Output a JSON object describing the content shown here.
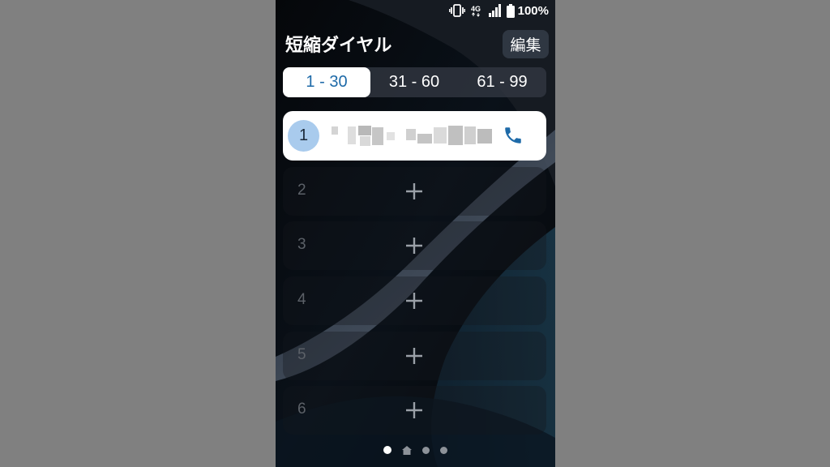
{
  "status_bar": {
    "icons": [
      "vibrate-icon",
      "4g-icon",
      "signal-icon",
      "battery-icon"
    ],
    "network": "4G",
    "battery": "100%"
  },
  "header": {
    "title": "短縮ダイヤル",
    "edit_label": "編集"
  },
  "tabs": [
    {
      "label": "1 - 30",
      "active": true
    },
    {
      "label": "31 - 60",
      "active": false
    },
    {
      "label": "61 - 99",
      "active": false
    }
  ],
  "entries": [
    {
      "number": "1",
      "assigned": true,
      "icon": "phone-icon"
    },
    {
      "number": "2",
      "assigned": false,
      "icon": "plus-icon"
    },
    {
      "number": "3",
      "assigned": false,
      "icon": "plus-icon"
    },
    {
      "number": "4",
      "assigned": false,
      "icon": "plus-icon"
    },
    {
      "number": "5",
      "assigned": false,
      "icon": "plus-icon"
    },
    {
      "number": "6",
      "assigned": false,
      "icon": "plus-icon"
    }
  ],
  "pager": {
    "pages": 4,
    "active_index": 0,
    "home_index": 1
  },
  "colors": {
    "accent": "#1e6aa8",
    "circle": "#a9cbed",
    "background": "#808080"
  }
}
